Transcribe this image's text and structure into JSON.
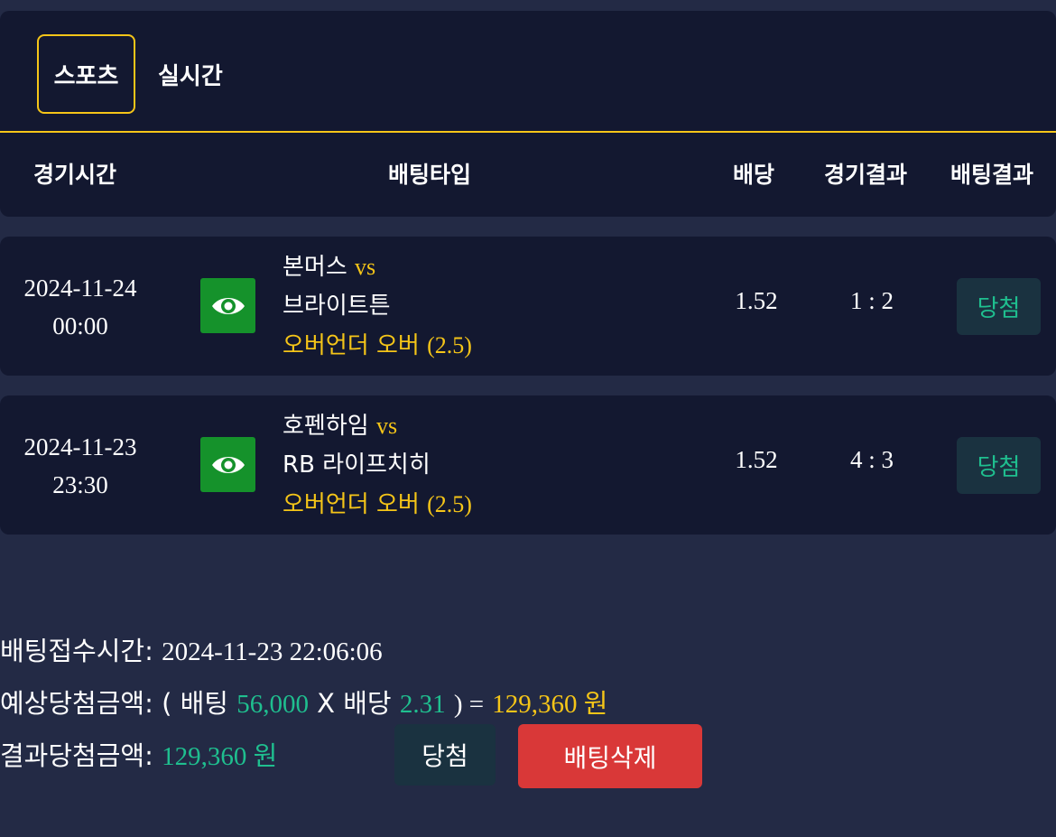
{
  "tabs": [
    {
      "label": "스포츠",
      "active": true
    },
    {
      "label": "실시간",
      "active": false
    }
  ],
  "columns": {
    "time": "경기시간",
    "bet_type": "배팅타입",
    "odds": "배당",
    "match_result": "경기결과",
    "bet_result": "배팅결과"
  },
  "bets": [
    {
      "date": "2024-11-24",
      "time": "00:00",
      "home": "본머스",
      "vs": "vs",
      "away": "브라이트튼",
      "bet_type": "오버언더 오버",
      "line": "(2.5)",
      "odds": "1.52",
      "score": "1 : 2",
      "result": "당첨"
    },
    {
      "date": "2024-11-23",
      "time": "23:30",
      "home": "호펜하임",
      "vs": "vs",
      "away": "RB 라이프치히",
      "bet_type": "오버언더 오버",
      "line": "(2.5)",
      "odds": "1.52",
      "score": "4 : 3",
      "result": "당첨"
    }
  ],
  "summary": {
    "received_label": "배팅접수시간:",
    "received_value": "2024-11-23 22:06:06",
    "expected_label": "예상당첨금액:",
    "expected_open": "( 배팅",
    "stake": "56,000",
    "times": "X 배당",
    "total_odds": "2.31",
    "equals": ") =",
    "expected_amount": "129,360 원",
    "result_label": "결과당첨금액:",
    "result_amount": "129,360 원"
  },
  "buttons": {
    "win": "당첨",
    "delete": "배팅삭제"
  },
  "icons": {
    "view": "eye-icon"
  },
  "colors": {
    "accent": "#f5c518",
    "win_green": "#1fbf8f",
    "delete_red": "#d93838",
    "eye_green": "#15922b"
  }
}
